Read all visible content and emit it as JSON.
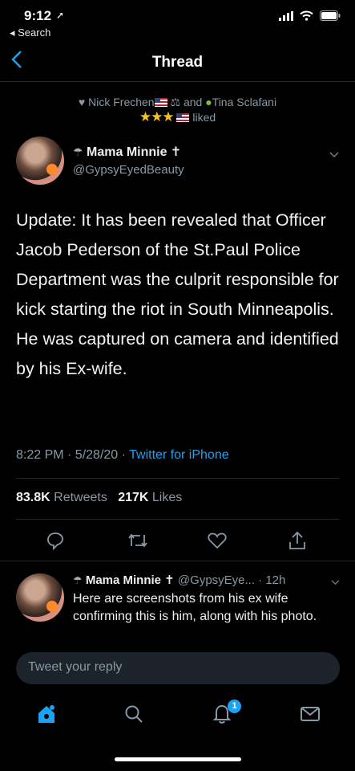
{
  "status_bar": {
    "time": "9:12",
    "back_label": "◂ Search"
  },
  "nav": {
    "title": "Thread"
  },
  "social_context": {
    "user1": "Nick Frechen",
    "conj": "and",
    "user2": "Tina Sclafani",
    "stars": "★★★",
    "action": "liked"
  },
  "tweet": {
    "author_name": "Mama Minnie ✝",
    "author_handle": "@GypsyEyedBeauty",
    "text": "Update: It has been revealed that Officer Jacob Pederson of the St.Paul Police Department was the culprit responsible for kick starting the riot in South Minneapolis. He was captured on camera and identified by his Ex-wife.",
    "time": "8:22 PM · 5/28/20 · ",
    "source": "Twitter for iPhone",
    "retweets_count": "83.8K",
    "retweets_label": "Retweets",
    "likes_count": "217K",
    "likes_label": "Likes"
  },
  "reply": {
    "author_name": "Mama Minnie ✝",
    "handle_time": "@GypsyEye... · 12h",
    "text": "Here are screenshots from his ex wife confirming this is him, along with his photo."
  },
  "compose": {
    "placeholder": "Tweet your reply"
  },
  "tabbar": {
    "notifications_badge": "1"
  },
  "colors": {
    "accent": "#1da1f2",
    "background": "#000000",
    "muted": "#8899a6"
  }
}
